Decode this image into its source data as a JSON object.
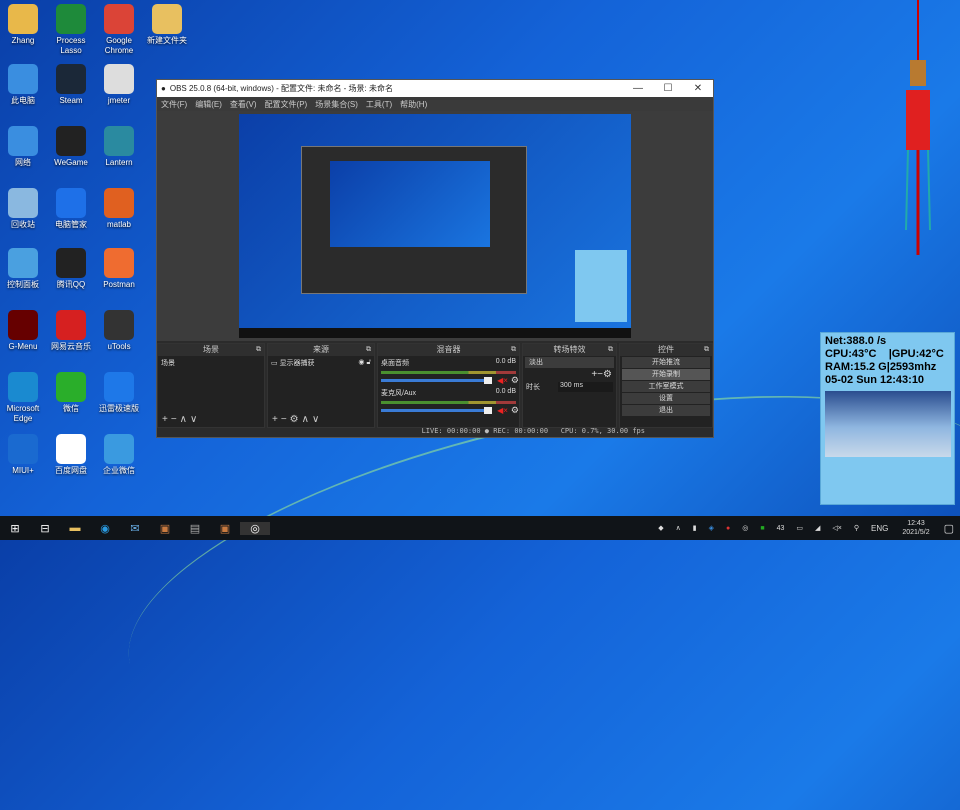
{
  "desktop_icons": [
    {
      "label": "Zhang",
      "color": "#e8b84a",
      "glyph": "folder-icon"
    },
    {
      "label": "Process Lasso",
      "color": "#1e8a3a",
      "glyph": "chart-icon"
    },
    {
      "label": "Google Chrome",
      "color": "#db4437",
      "glyph": "chrome-icon"
    },
    {
      "label": "新建文件夹",
      "color": "#e8c060",
      "glyph": "folder-icon"
    },
    {
      "label": "此电脑",
      "color": "#3a8ee0",
      "glyph": "computer-icon"
    },
    {
      "label": "Steam",
      "color": "#1b2838",
      "glyph": "steam-icon"
    },
    {
      "label": "jmeter",
      "color": "#ddd",
      "glyph": "gear-icon"
    },
    {
      "label": "网络",
      "color": "#3a8ee0",
      "glyph": "network-icon"
    },
    {
      "label": "WeGame",
      "color": "#222",
      "glyph": "wegame-icon"
    },
    {
      "label": "Lantern",
      "color": "#2a8aa0",
      "glyph": "lantern-icon"
    },
    {
      "label": "回收站",
      "color": "#8ab8e0",
      "glyph": "recycle-bin-icon"
    },
    {
      "label": "电脑管家",
      "color": "#1e70e8",
      "glyph": "shield-icon"
    },
    {
      "label": "matlab",
      "color": "#e06020",
      "glyph": "matlab-icon"
    },
    {
      "label": "控制面板",
      "color": "#4aa0e0",
      "glyph": "control-panel-icon"
    },
    {
      "label": "腾讯QQ",
      "color": "#222",
      "glyph": "qq-icon"
    },
    {
      "label": "Postman",
      "color": "#ef6c30",
      "glyph": "postman-icon"
    },
    {
      "label": "G-Menu",
      "color": "#600",
      "glyph": "gmenu-icon"
    },
    {
      "label": "网易云音乐",
      "color": "#d62020",
      "glyph": "music-icon"
    },
    {
      "label": "uTools",
      "color": "#333",
      "glyph": "utools-icon"
    },
    {
      "label": "Microsoft Edge",
      "color": "#1a8ad0",
      "glyph": "edge-icon"
    },
    {
      "label": "微信",
      "color": "#2aae2a",
      "glyph": "wechat-icon"
    },
    {
      "label": "迅雷极速版",
      "color": "#1e78e8",
      "glyph": "thunder-icon"
    },
    {
      "label": "MIUI+",
      "color": "#1a6ad0",
      "glyph": "miui-icon"
    },
    {
      "label": "百度网盘",
      "color": "#fff",
      "glyph": "baidu-netdisk-icon"
    },
    {
      "label": "企业微信",
      "color": "#3a9ae0",
      "glyph": "wecom-icon"
    }
  ],
  "obs": {
    "title": "OBS 25.0.8 (64-bit, windows) - 配置文件: 未命名 - 场景: 未命名",
    "menu": [
      "文件(F)",
      "编辑(E)",
      "查看(V)",
      "配置文件(P)",
      "场景集合(S)",
      "工具(T)",
      "帮助(H)"
    ],
    "docks": {
      "scenes": {
        "title": "场景",
        "items": [
          "场景"
        ]
      },
      "sources": {
        "title": "来源",
        "items": [
          "显示器捕获"
        ]
      },
      "mixer": {
        "title": "混音器",
        "channels": [
          {
            "name": "桌面音频",
            "db": "0.0 dB",
            "level": 0
          },
          {
            "name": "麦克风/Aux",
            "db": "0.0 dB",
            "level": 1
          }
        ]
      },
      "transitions": {
        "title": "转场特效",
        "selected": "淡出",
        "duration_label": "时长",
        "duration": "300 ms"
      },
      "controls": {
        "title": "控件",
        "buttons": [
          "开始推流",
          "开始录制",
          "工作室模式",
          "设置",
          "退出"
        ]
      }
    },
    "status": {
      "live": "LIVE: 00:00:00",
      "rec": "REC: 00:00:00",
      "cpu": "CPU: 0.7%, 30.00 fps"
    }
  },
  "widget": {
    "lines": [
      "Net:388.0 /s",
      "CPU:43°C    |GPU:42°C",
      "RAM:15.2 G|2593mhz",
      "05-02 Sun 12:43:10"
    ]
  },
  "taskbar": {
    "lang": "ENG",
    "time": "12:43",
    "date": "2021/5/2",
    "tray_badge": "43"
  }
}
